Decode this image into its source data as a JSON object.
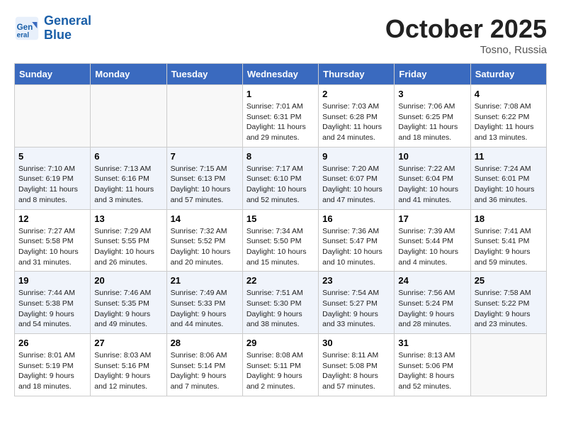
{
  "header": {
    "logo_line1": "General",
    "logo_line2": "Blue",
    "month": "October 2025",
    "location": "Tosno, Russia"
  },
  "weekdays": [
    "Sunday",
    "Monday",
    "Tuesday",
    "Wednesday",
    "Thursday",
    "Friday",
    "Saturday"
  ],
  "weeks": [
    [
      {
        "day": "",
        "info": ""
      },
      {
        "day": "",
        "info": ""
      },
      {
        "day": "",
        "info": ""
      },
      {
        "day": "1",
        "info": "Sunrise: 7:01 AM\nSunset: 6:31 PM\nDaylight: 11 hours\nand 29 minutes."
      },
      {
        "day": "2",
        "info": "Sunrise: 7:03 AM\nSunset: 6:28 PM\nDaylight: 11 hours\nand 24 minutes."
      },
      {
        "day": "3",
        "info": "Sunrise: 7:06 AM\nSunset: 6:25 PM\nDaylight: 11 hours\nand 18 minutes."
      },
      {
        "day": "4",
        "info": "Sunrise: 7:08 AM\nSunset: 6:22 PM\nDaylight: 11 hours\nand 13 minutes."
      }
    ],
    [
      {
        "day": "5",
        "info": "Sunrise: 7:10 AM\nSunset: 6:19 PM\nDaylight: 11 hours\nand 8 minutes."
      },
      {
        "day": "6",
        "info": "Sunrise: 7:13 AM\nSunset: 6:16 PM\nDaylight: 11 hours\nand 3 minutes."
      },
      {
        "day": "7",
        "info": "Sunrise: 7:15 AM\nSunset: 6:13 PM\nDaylight: 10 hours\nand 57 minutes."
      },
      {
        "day": "8",
        "info": "Sunrise: 7:17 AM\nSunset: 6:10 PM\nDaylight: 10 hours\nand 52 minutes."
      },
      {
        "day": "9",
        "info": "Sunrise: 7:20 AM\nSunset: 6:07 PM\nDaylight: 10 hours\nand 47 minutes."
      },
      {
        "day": "10",
        "info": "Sunrise: 7:22 AM\nSunset: 6:04 PM\nDaylight: 10 hours\nand 41 minutes."
      },
      {
        "day": "11",
        "info": "Sunrise: 7:24 AM\nSunset: 6:01 PM\nDaylight: 10 hours\nand 36 minutes."
      }
    ],
    [
      {
        "day": "12",
        "info": "Sunrise: 7:27 AM\nSunset: 5:58 PM\nDaylight: 10 hours\nand 31 minutes."
      },
      {
        "day": "13",
        "info": "Sunrise: 7:29 AM\nSunset: 5:55 PM\nDaylight: 10 hours\nand 26 minutes."
      },
      {
        "day": "14",
        "info": "Sunrise: 7:32 AM\nSunset: 5:52 PM\nDaylight: 10 hours\nand 20 minutes."
      },
      {
        "day": "15",
        "info": "Sunrise: 7:34 AM\nSunset: 5:50 PM\nDaylight: 10 hours\nand 15 minutes."
      },
      {
        "day": "16",
        "info": "Sunrise: 7:36 AM\nSunset: 5:47 PM\nDaylight: 10 hours\nand 10 minutes."
      },
      {
        "day": "17",
        "info": "Sunrise: 7:39 AM\nSunset: 5:44 PM\nDaylight: 10 hours\nand 4 minutes."
      },
      {
        "day": "18",
        "info": "Sunrise: 7:41 AM\nSunset: 5:41 PM\nDaylight: 9 hours\nand 59 minutes."
      }
    ],
    [
      {
        "day": "19",
        "info": "Sunrise: 7:44 AM\nSunset: 5:38 PM\nDaylight: 9 hours\nand 54 minutes."
      },
      {
        "day": "20",
        "info": "Sunrise: 7:46 AM\nSunset: 5:35 PM\nDaylight: 9 hours\nand 49 minutes."
      },
      {
        "day": "21",
        "info": "Sunrise: 7:49 AM\nSunset: 5:33 PM\nDaylight: 9 hours\nand 44 minutes."
      },
      {
        "day": "22",
        "info": "Sunrise: 7:51 AM\nSunset: 5:30 PM\nDaylight: 9 hours\nand 38 minutes."
      },
      {
        "day": "23",
        "info": "Sunrise: 7:54 AM\nSunset: 5:27 PM\nDaylight: 9 hours\nand 33 minutes."
      },
      {
        "day": "24",
        "info": "Sunrise: 7:56 AM\nSunset: 5:24 PM\nDaylight: 9 hours\nand 28 minutes."
      },
      {
        "day": "25",
        "info": "Sunrise: 7:58 AM\nSunset: 5:22 PM\nDaylight: 9 hours\nand 23 minutes."
      }
    ],
    [
      {
        "day": "26",
        "info": "Sunrise: 8:01 AM\nSunset: 5:19 PM\nDaylight: 9 hours\nand 18 minutes."
      },
      {
        "day": "27",
        "info": "Sunrise: 8:03 AM\nSunset: 5:16 PM\nDaylight: 9 hours\nand 12 minutes."
      },
      {
        "day": "28",
        "info": "Sunrise: 8:06 AM\nSunset: 5:14 PM\nDaylight: 9 hours\nand 7 minutes."
      },
      {
        "day": "29",
        "info": "Sunrise: 8:08 AM\nSunset: 5:11 PM\nDaylight: 9 hours\nand 2 minutes."
      },
      {
        "day": "30",
        "info": "Sunrise: 8:11 AM\nSunset: 5:08 PM\nDaylight: 8 hours\nand 57 minutes."
      },
      {
        "day": "31",
        "info": "Sunrise: 8:13 AM\nSunset: 5:06 PM\nDaylight: 8 hours\nand 52 minutes."
      },
      {
        "day": "",
        "info": ""
      }
    ]
  ]
}
